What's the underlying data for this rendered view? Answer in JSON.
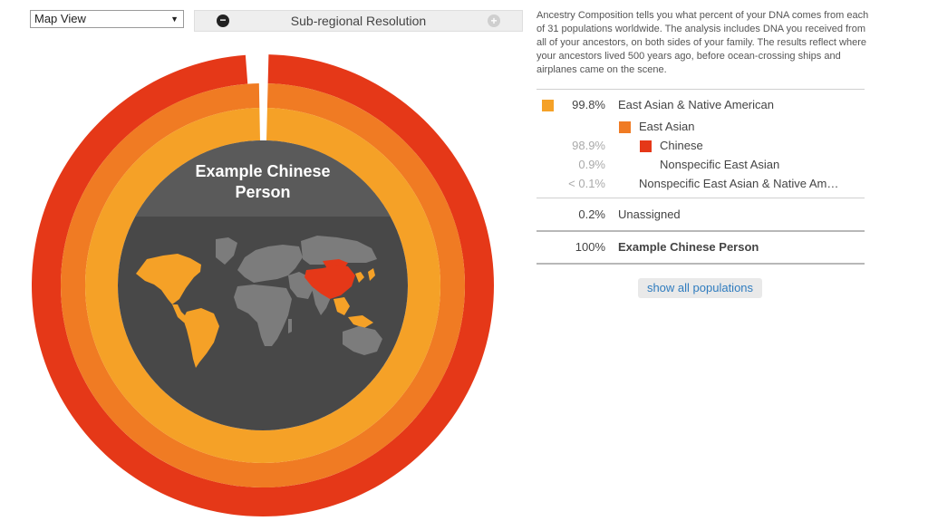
{
  "controls": {
    "view_select": "Map View",
    "resolution_label": "Sub-regional Resolution",
    "minus_glyph": "−",
    "plus_glyph": "+"
  },
  "chart": {
    "center_title_line1": "Example Chinese",
    "center_title_line2": "Person"
  },
  "intro": "Ancestry Composition tells you what percent of your DNA comes from each of 31 populations worldwide. The analysis includes DNA you received from all of your ancestors, on both sides of your family. The results reflect where your ancestors lived 500 years ago, before ocean-crossing ships and airplanes came on the scene.",
  "breakdown": {
    "rows": [
      {
        "percent": "99.8%",
        "name": "East Asian & Native American",
        "color": "#f5a127"
      },
      {
        "percent": "",
        "name": "East Asian",
        "color": "#f07b23"
      },
      {
        "percent": "98.9%",
        "name": "Chinese",
        "color": "#e53818"
      },
      {
        "percent": "0.9%",
        "name": "Nonspecific East Asian"
      },
      {
        "percent": "< 0.1%",
        "name": "Nonspecific East Asian & Native Am…"
      }
    ],
    "unassigned": {
      "percent": "0.2%",
      "name": "Unassigned"
    },
    "total": {
      "percent": "100%",
      "name": "Example Chinese Person"
    },
    "show_all_label": "show all populations"
  },
  "chart_data": {
    "type": "pie",
    "title": "",
    "rings": [
      {
        "name": "East Asian & Native American",
        "value": 99.8,
        "color": "#f5a127"
      },
      {
        "name": "East Asian",
        "value": 99.8,
        "color": "#f07b23"
      },
      {
        "name": "Chinese",
        "value": 98.9,
        "color": "#e53818"
      }
    ],
    "colors": {
      "map_background": "#484848",
      "map_header": "#5a5a5a",
      "land_default": "#7c7c7c",
      "land_highlight": "#e53818",
      "land_secondary": "#f5a127"
    }
  }
}
